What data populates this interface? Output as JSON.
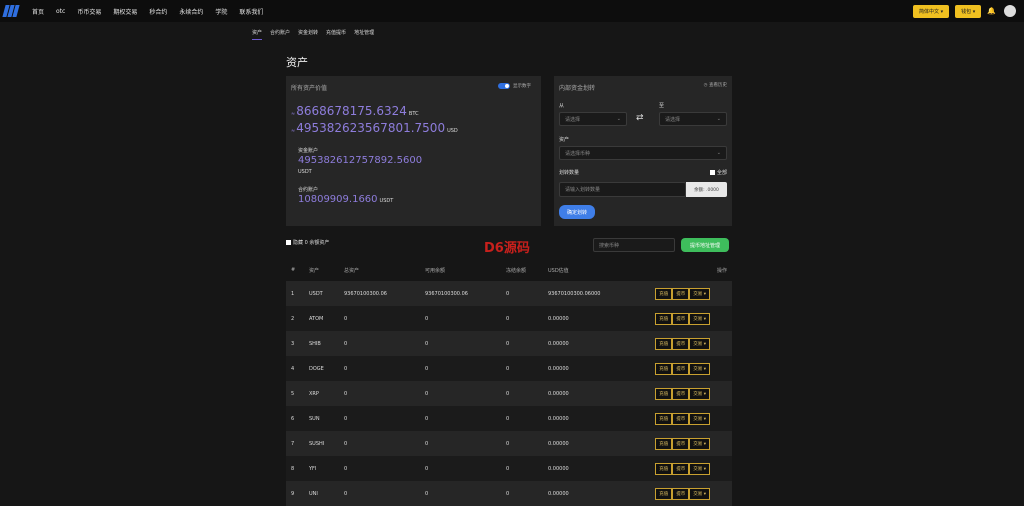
{
  "nav": {
    "items": [
      "首页",
      "otc",
      "币币交易",
      "期权交易",
      "秒合约",
      "永续合约",
      "学院",
      "联系我们"
    ],
    "lang_label": "简体中文",
    "wallet_label": "钱包"
  },
  "subnav": [
    "资产",
    "合约账户",
    "资金划转",
    "充值提币",
    "地址管理"
  ],
  "page_title": "资产",
  "overview": {
    "title": "所有资产价值",
    "show_digits_label": "显示数字",
    "btc_prefix": "≈",
    "btc_value": "8668678175.6324",
    "btc_unit": "BTC",
    "usd_prefix": "≈",
    "usd_value": "495382623567801.7500",
    "usd_unit": "USD",
    "fund_label": "资金账户",
    "fund_value": "495382612757892.5600",
    "fund_unit": "USDT",
    "contract_label": "合约账户",
    "contract_value": "10809909.1660",
    "contract_unit": "USDT"
  },
  "transfer": {
    "title": "内部资金划转",
    "history_label": "查看历史",
    "from_label": "从",
    "to_label": "至",
    "from_placeholder": "请选择",
    "to_placeholder": "请选择",
    "asset_label": "资产",
    "asset_placeholder": "请选择币种",
    "amount_label": "划转数量",
    "all_label": "全部",
    "amount_placeholder": "请输入划转数量",
    "balance_text": "余额: .0000",
    "confirm_label": "确定划转"
  },
  "filter": {
    "hide_zero_label": "隐藏 0 余额资产",
    "search_placeholder": "搜索币种",
    "address_mgmt_label": "提币地址管理"
  },
  "watermark": "D6源码",
  "table": {
    "headers": [
      "#",
      "资产",
      "总资产",
      "可用余额",
      "冻结余额",
      "USD估值",
      "操作"
    ],
    "actions": [
      "充值",
      "提币",
      "交易 ▾"
    ],
    "rows": [
      {
        "idx": "1",
        "coin": "USDT",
        "total": "93670100300.06",
        "avail": "93670100300.06",
        "frozen": "0",
        "usd": "93670100300.06000"
      },
      {
        "idx": "2",
        "coin": "ATOM",
        "total": "0",
        "avail": "0",
        "frozen": "0",
        "usd": "0.00000"
      },
      {
        "idx": "3",
        "coin": "SHIB",
        "total": "0",
        "avail": "0",
        "frozen": "0",
        "usd": "0.00000"
      },
      {
        "idx": "4",
        "coin": "DOGE",
        "total": "0",
        "avail": "0",
        "frozen": "0",
        "usd": "0.00000"
      },
      {
        "idx": "5",
        "coin": "XRP",
        "total": "0",
        "avail": "0",
        "frozen": "0",
        "usd": "0.00000"
      },
      {
        "idx": "6",
        "coin": "SUN",
        "total": "0",
        "avail": "0",
        "frozen": "0",
        "usd": "0.00000"
      },
      {
        "idx": "7",
        "coin": "SUSHI",
        "total": "0",
        "avail": "0",
        "frozen": "0",
        "usd": "0.00000"
      },
      {
        "idx": "8",
        "coin": "YFI",
        "total": "0",
        "avail": "0",
        "frozen": "0",
        "usd": "0.00000"
      },
      {
        "idx": "9",
        "coin": "UNI",
        "total": "0",
        "avail": "0",
        "frozen": "0",
        "usd": "0.00000"
      }
    ]
  }
}
